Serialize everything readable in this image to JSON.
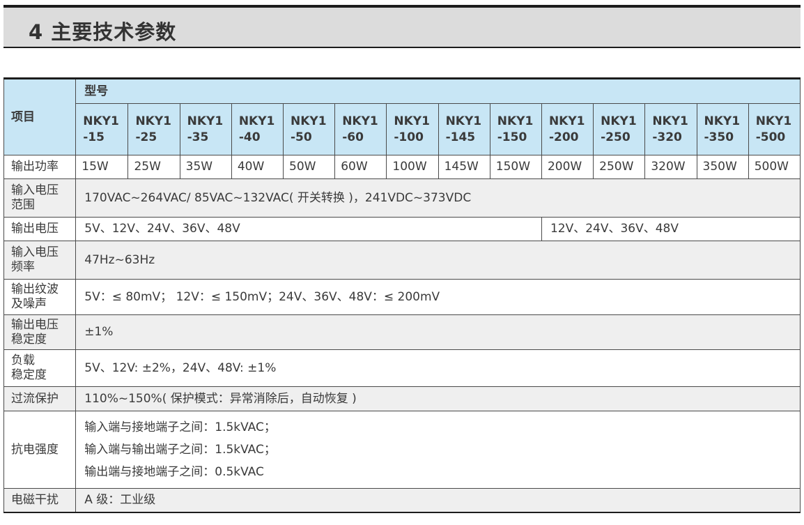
{
  "section": {
    "title": "4 主要技术参数"
  },
  "table": {
    "item_header": "项目",
    "model_group_label": "型号",
    "models": [
      "NKY1\n-15",
      "NKY1\n-25",
      "NKY1\n-35",
      "NKY1\n-40",
      "NKY1\n-50",
      "NKY1\n-60",
      "NKY1\n-100",
      "NKY1\n-145",
      "NKY1\n-150",
      "NKY1\n-200",
      "NKY1\n-250",
      "NKY1\n-320",
      "NKY1\n-350",
      "NKY1\n-500"
    ],
    "output_power": {
      "label": "输出功率",
      "values": [
        "15W",
        "25W",
        "35W",
        "40W",
        "50W",
        "60W",
        "100W",
        "145W",
        "150W",
        "200W",
        "250W",
        "320W",
        "350W",
        "500W"
      ]
    },
    "input_voltage_range": {
      "label": "输入电压\n范围",
      "value": "170VAC~264VAC/ 85VAC~132VAC( 开关转换 )，241VDC~373VDC"
    },
    "output_voltage": {
      "label": "输出电压",
      "value_low": "5V、12V、24V、36V、48V",
      "value_high": "12V、24V、36V、48V"
    },
    "input_frequency": {
      "label": "输入电压\n频率",
      "value": "47Hz~63Hz"
    },
    "ripple_noise": {
      "label": "输出纹波\n及噪声",
      "value": "5V：≤ 80mV； 12V：≤ 150mV；24V、36V、48V：≤ 200mV"
    },
    "voltage_stability": {
      "label": "输出电压\n稳定度",
      "value": "±1%"
    },
    "load_stability": {
      "label": "负载\n稳定度",
      "value": "5V、12V: ±2%，24V、48V: ±1%"
    },
    "overcurrent": {
      "label": "过流保护",
      "value": "110%~150%( 保护模式：异常消除后，自动恢复 )"
    },
    "dielectric_strength": {
      "label": "抗电强度",
      "lines": [
        "输入端与接地端子之间：1.5kVAC；",
        "输入端与输出端子之间：1.5kVAC；",
        "输出端与接地端子之间：0.5kVAC"
      ]
    },
    "emi": {
      "label": "电磁干扰",
      "value": "A 级：工业级"
    }
  }
}
